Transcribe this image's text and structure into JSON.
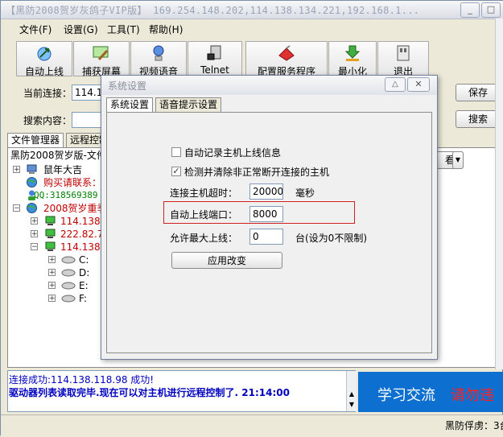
{
  "window": {
    "title": "【黑防2008贺岁灰鸽子VIP版】 169.254.148.202,114.138.134.221,192.168.1...",
    "controls": [
      "_",
      "□"
    ]
  },
  "menu": [
    "文件(F)",
    "设置(G)",
    "工具(T)",
    "帮助(H)"
  ],
  "toolbar": [
    {
      "label": "自动上线",
      "icon": "network-up-icon"
    },
    {
      "label": "捕获屏幕",
      "icon": "screen-capture-icon"
    },
    {
      "label": "视频语音",
      "icon": "video-voice-icon"
    },
    {
      "label": "Telnet",
      "icon": "telnet-icon"
    },
    {
      "label": "配置服务程序",
      "icon": "configure-service-icon"
    },
    {
      "label": "最小化",
      "icon": "minimize-arrow-icon"
    },
    {
      "label": "退出",
      "icon": "exit-icon"
    }
  ],
  "connection": {
    "label": "当前连接：",
    "value": "114.13",
    "save_button": "保存"
  },
  "search": {
    "label": "搜索内容：",
    "button": "搜索"
  },
  "tabs": [
    "文件管理器",
    "远程控制"
  ],
  "view_button": "看",
  "tree": {
    "root": "黑防2008贺岁版-文件",
    "items": [
      {
        "text": "鼠年大吉",
        "color": "#000000"
      },
      {
        "text": "购买请联系：",
        "color": "#c00000"
      },
      {
        "text": "QQ:318569389",
        "color": "#008000"
      },
      {
        "text": "2008贺岁重季",
        "color": "#c00000"
      },
      {
        "text": "114.138.",
        "color": "#c00000"
      },
      {
        "text": "222.82.70",
        "color": "#c00000"
      },
      {
        "text": "114.138.",
        "color": "#c00000"
      },
      {
        "text": "C:",
        "color": "#000000"
      },
      {
        "text": "D:",
        "color": "#000000"
      },
      {
        "text": "E:",
        "color": "#000000"
      },
      {
        "text": "F:",
        "color": "#000000"
      }
    ]
  },
  "log": {
    "line1": "连接成功:114.138.118.98 成功!",
    "line2": "驱动器列表读取完毕.现在可以对主机进行远程控制了. 21:14:00",
    "colors": {
      "line1": "#0000c0",
      "line2": "#0000c0"
    }
  },
  "banner": {
    "text1": "学习交流",
    "text2": "请勿违",
    "colors": {
      "bg": "#0d6fd0",
      "text1": "#ffffff",
      "text2": "#ff2020"
    }
  },
  "status": {
    "text": "黑防俘虏：3台"
  },
  "dialog": {
    "title": "系统设置",
    "tabs": [
      "系统设置",
      "语音提示设置"
    ],
    "auto_record_label": "自动记录主机上线信息",
    "auto_record_checked": false,
    "detect_clear_label": "检测并清除非正常断开连接的主机",
    "detect_clear_checked": true,
    "timeout_label": "连接主机超时：",
    "timeout_value": "20000",
    "timeout_unit": "毫秒",
    "port_label": "自动上线端口：",
    "port_value": "8000",
    "max_label": "允许最大上线：",
    "max_value": "0",
    "max_unit": "台(设为0不限制)",
    "apply_button": "应用改变",
    "highlight_color": "#d02020"
  }
}
